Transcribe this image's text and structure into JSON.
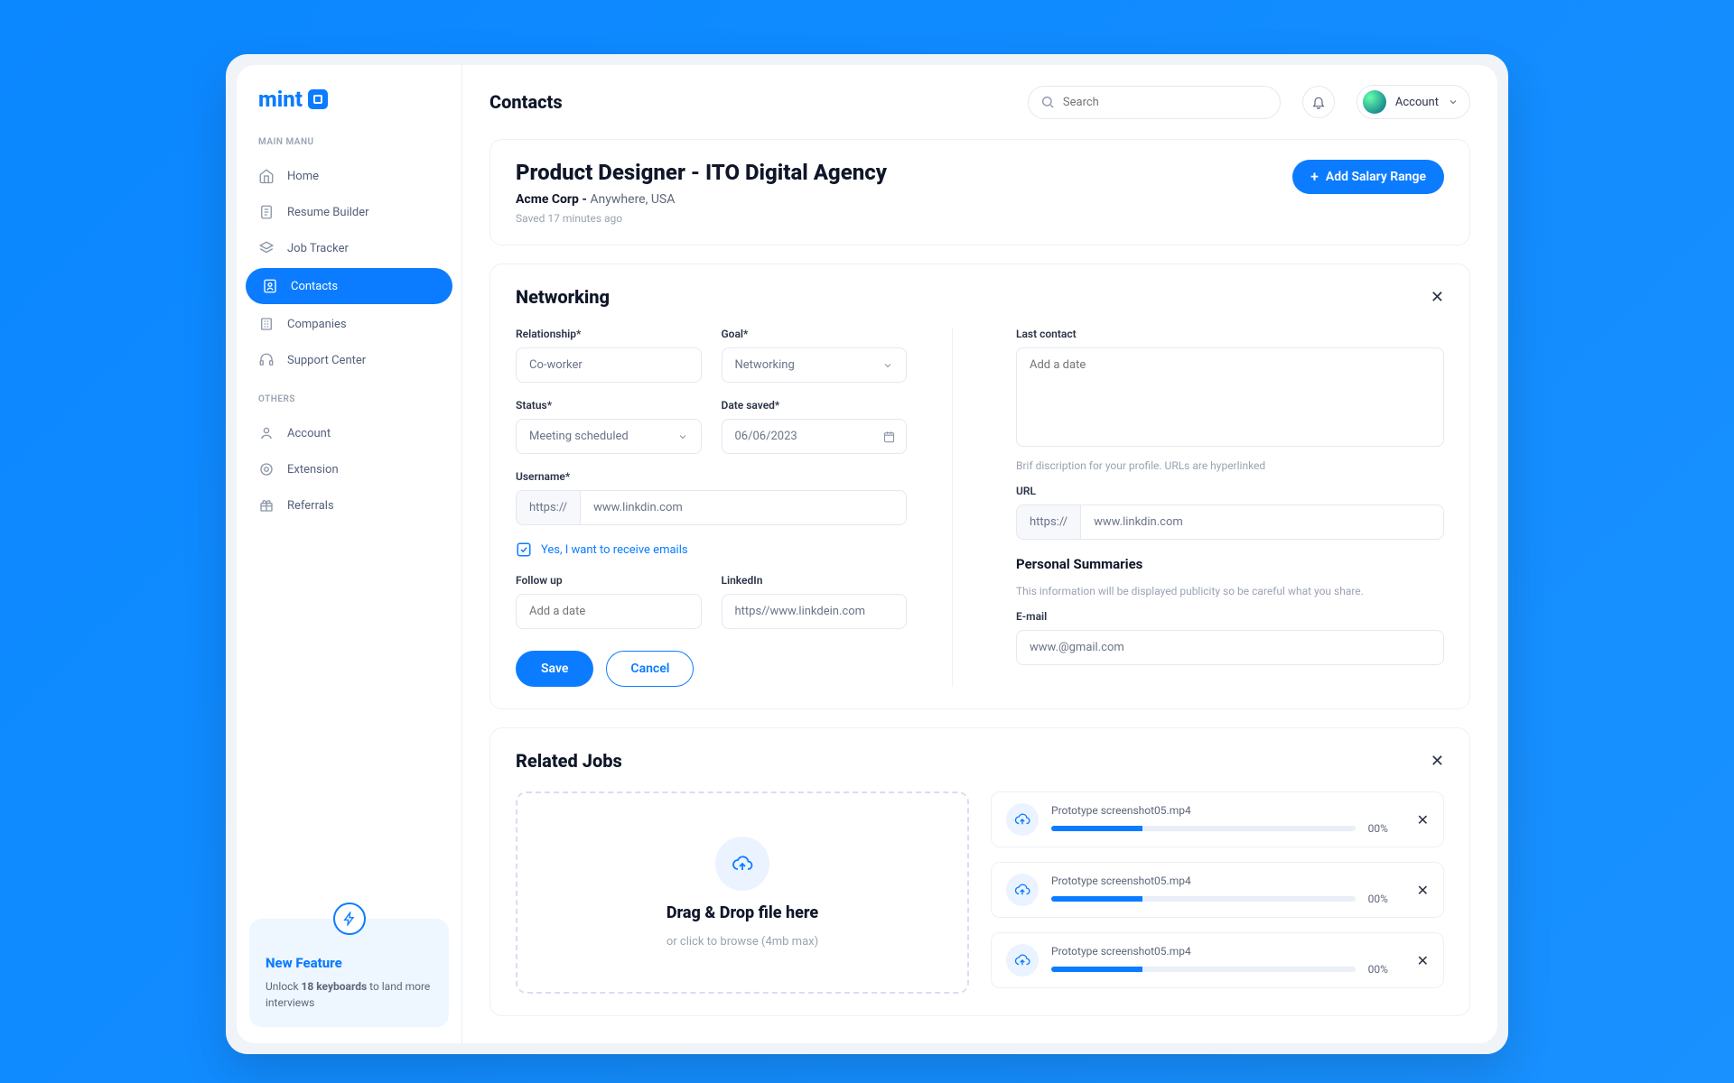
{
  "brand": {
    "name": "mint"
  },
  "sidebar": {
    "section1_title": "MAIN MANU",
    "section2_title": "OTHERS",
    "items_main": [
      {
        "label": "Home"
      },
      {
        "label": "Resume Builder"
      },
      {
        "label": "Job Tracker"
      },
      {
        "label": "Contacts"
      },
      {
        "label": "Companies"
      },
      {
        "label": "Support Center"
      }
    ],
    "items_other": [
      {
        "label": "Account"
      },
      {
        "label": "Extension"
      },
      {
        "label": "Referrals"
      }
    ],
    "feature": {
      "title": "New Feature",
      "body_pre": "Unlock ",
      "body_bold": "18 keyboards",
      "body_post": " to land more interviews"
    }
  },
  "topbar": {
    "title": "Contacts",
    "search_placeholder": "Search",
    "account_label": "Account"
  },
  "hero": {
    "title": "Product Designer - ITO Digital Agency",
    "company": "Acme Corp - ",
    "location": "Anywhere, USA",
    "saved": "Saved 17 minutes ago",
    "cta": "Add Salary Range"
  },
  "networking": {
    "title": "Networking",
    "relationship_label": "Relationship*",
    "relationship_value": "Co-worker",
    "goal_label": "Goal*",
    "goal_value": "Networking",
    "status_label": "Status*",
    "status_value": "Meeting scheduled",
    "date_saved_label": "Date saved*",
    "date_saved_value": "06/06/2023",
    "username_label": "Username*",
    "username_prefix": "https://",
    "username_value": "www.linkdin.com",
    "receive_emails": "Yes, I want to receive emails",
    "followup_label": "Follow up",
    "followup_placeholder": "Add a date",
    "linkedin_label": "LinkedIn",
    "linkedin_value": "https//www.linkdein.com",
    "save": "Save",
    "cancel": "Cancel",
    "last_contact_label": "Last contact",
    "last_contact_placeholder": "Add a date",
    "desc_hint": "Brif discription for your profile. URLs are hyperlinked",
    "url_label": "URL",
    "url_prefix": "https://",
    "url_value": "www.linkdin.com",
    "summaries_title": "Personal Summaries",
    "summaries_hint": "This information will be displayed publicity so be careful what you share.",
    "email_label": "E-mail",
    "email_value": "www.@gmail.com"
  },
  "related": {
    "title": "Related Jobs",
    "dz_title": "Drag & Drop file here",
    "dz_sub": "or click to browse (4mb max)",
    "uploads": [
      {
        "name": "Prototype screenshot05.mp4",
        "pct": "00%"
      },
      {
        "name": "Prototype screenshot05.mp4",
        "pct": "00%"
      },
      {
        "name": "Prototype screenshot05.mp4",
        "pct": "00%"
      }
    ]
  }
}
